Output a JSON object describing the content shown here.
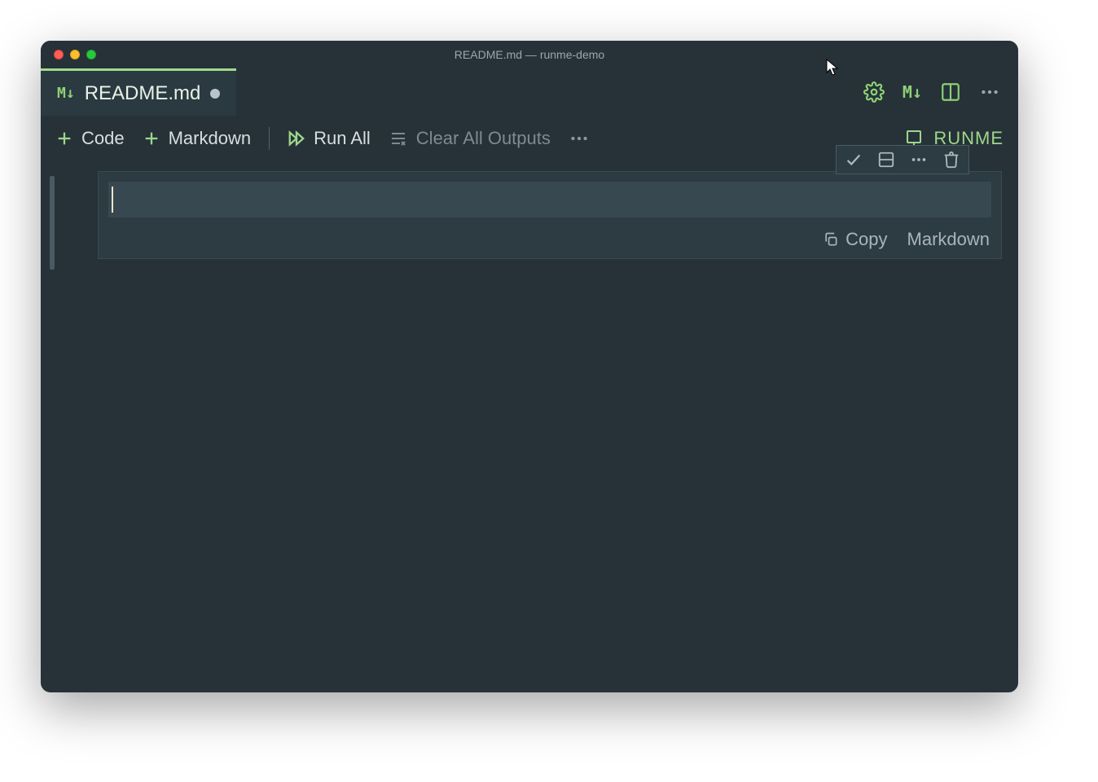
{
  "window": {
    "title": "README.md — runme-demo"
  },
  "tab": {
    "label": "README.md"
  },
  "tabbar_right": {
    "md_badge": "M↓"
  },
  "toolbar": {
    "code_label": "Code",
    "markdown_label": "Markdown",
    "runall_label": "Run All",
    "clear_label": "Clear All Outputs"
  },
  "runme": {
    "label": "RUNME"
  },
  "cell": {
    "copy_label": "Copy",
    "lang_label": "Markdown",
    "content": ""
  }
}
